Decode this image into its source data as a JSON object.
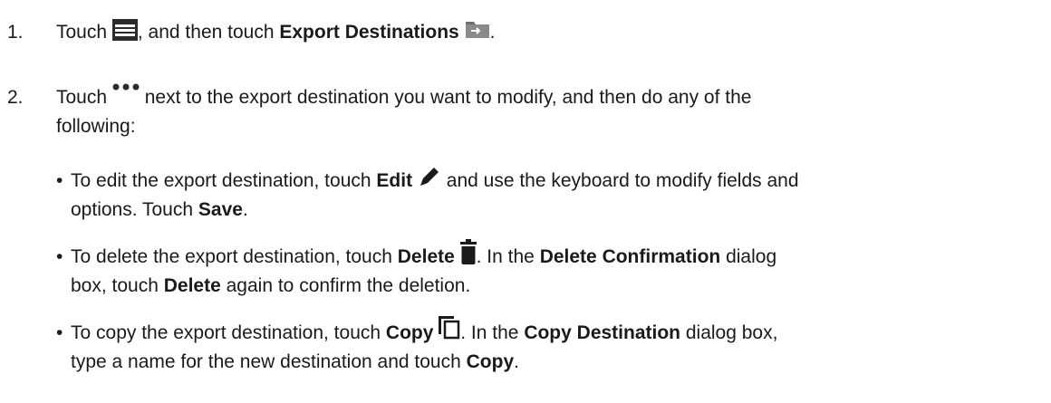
{
  "steps": [
    {
      "number": "1.",
      "parts": {
        "touch": "Touch",
        "and_then_touch": ", and then touch",
        "export_destinations": "Export Destinations",
        "end": "."
      },
      "icons": [
        "menu-icon",
        "export-destinations-icon"
      ]
    },
    {
      "number": "2.",
      "parts": {
        "touch": "Touch",
        "rest_line1": "next to the export destination you want to modify, and then do any of the",
        "rest_line2": "following:"
      },
      "icons": [
        "more-options-icon"
      ]
    }
  ],
  "bullets": [
    {
      "dot": "•",
      "parts": {
        "a": "To edit the export destination, touch",
        "edit": "Edit",
        "b": "and use the keyboard to modify fields and",
        "c": "options. Touch",
        "save": "Save",
        "d": "."
      },
      "icon": "edit-pencil-icon"
    },
    {
      "dot": "•",
      "parts": {
        "a": "To delete the export destination, touch",
        "delete": "Delete",
        "b": ". In the",
        "delete_confirmation": "Delete Confirmation",
        "c": "dialog",
        "d": "box, touch",
        "delete2": "Delete",
        "e": "again to confirm the deletion."
      },
      "icon": "trash-icon"
    },
    {
      "dot": "•",
      "parts": {
        "a": "To copy the export destination, touch",
        "copy": "Copy",
        "b": ". In the",
        "copy_destination": "Copy Destination",
        "c": "dialog box,",
        "d": "type a name for the new destination and touch",
        "copy2": "Copy",
        "e": "."
      },
      "icon": "copy-icon"
    }
  ],
  "colors": {
    "text": "#1a1a1a",
    "icon_dark": "#2b2b2b",
    "icon_grey": "#6e6e6e"
  }
}
